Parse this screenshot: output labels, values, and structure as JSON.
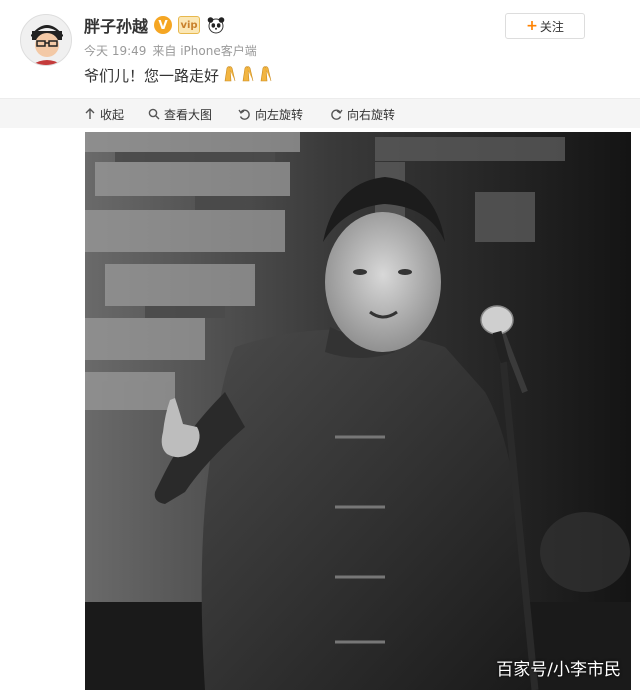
{
  "post": {
    "username": "胖子孙越",
    "verified_badge": "V",
    "vip_badge": "vip",
    "time": "今天 19:49",
    "source": "来自 iPhone客户端",
    "text": "爷们儿！您一路走好",
    "emoji_count": 3,
    "follow_label": "关注"
  },
  "toolbar": {
    "collapse_label": "收起",
    "view_large_label": "查看大图",
    "rotate_left_label": "向左旋转",
    "rotate_right_label": "向右旋转"
  },
  "watermark": "百家号/小李市民",
  "colors": {
    "accent_orange": "#ff8200",
    "verified": "#f5a623",
    "meta_gray": "#999999",
    "toolbar_bg": "#f5f5f5"
  },
  "icons": [
    "avatar",
    "verified-icon",
    "vip-icon",
    "panda-icon",
    "pray-icon",
    "collapse-icon",
    "search-icon",
    "rotate-left-icon",
    "rotate-right-icon"
  ]
}
